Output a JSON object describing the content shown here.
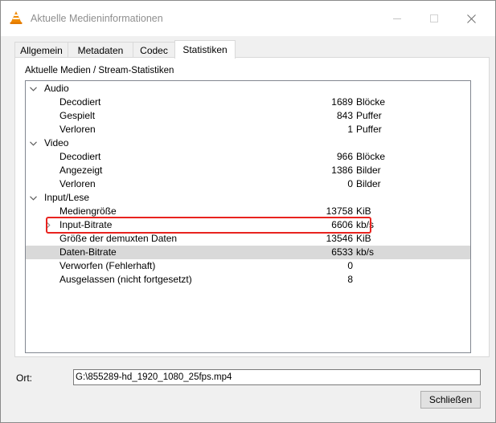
{
  "window": {
    "title": "Aktuelle Medieninformationen"
  },
  "tabs": [
    {
      "label": "Allgemein"
    },
    {
      "label": "Metadaten"
    },
    {
      "label": "Codec"
    },
    {
      "label": "Statistiken",
      "active": true
    }
  ],
  "panel": {
    "section_label": "Aktuelle Medien / Stream-Statistiken"
  },
  "tree": [
    {
      "label": "Audio",
      "level": 0,
      "expander": "expanded"
    },
    {
      "label": "Decodiert",
      "level": 1,
      "value": "1689",
      "unit": "Blöcke"
    },
    {
      "label": "Gespielt",
      "level": 1,
      "value": "843",
      "unit": "Puffer"
    },
    {
      "label": "Verloren",
      "level": 1,
      "value": "1",
      "unit": "Puffer"
    },
    {
      "label": "Video",
      "level": 0,
      "expander": "expanded"
    },
    {
      "label": "Decodiert",
      "level": 1,
      "value": "966",
      "unit": "Blöcke"
    },
    {
      "label": "Angezeigt",
      "level": 1,
      "value": "1386",
      "unit": "Bilder"
    },
    {
      "label": "Verloren",
      "level": 1,
      "value": "0",
      "unit": "Bilder"
    },
    {
      "label": "Input/Lese",
      "level": 0,
      "expander": "expanded"
    },
    {
      "label": "Mediengröße",
      "level": 1,
      "value": "13758",
      "unit": "KiB"
    },
    {
      "label": "Input-Bitrate",
      "level": 1,
      "value": "6606",
      "unit": "kb/s",
      "expander": "collapsed"
    },
    {
      "label": "Größe der demuxten Daten",
      "level": 1,
      "value": "13546",
      "unit": "KiB"
    },
    {
      "label": "Daten-Bitrate",
      "level": 1,
      "value": "6533",
      "unit": "kb/s",
      "selected": true,
      "highlighted": true
    },
    {
      "label": "Verworfen (Fehlerhaft)",
      "level": 1,
      "value": "0",
      "unit": ""
    },
    {
      "label": "Ausgelassen (nicht fortgesetzt)",
      "level": 1,
      "value": "8",
      "unit": ""
    }
  ],
  "location": {
    "label": "Ort:",
    "value": "G:\\855289-hd_1920_1080_25fps.mp4"
  },
  "buttons": {
    "close": "Schließen"
  },
  "colors": {
    "highlight_border": "#e8231f",
    "selected_row": "#d9d9d9"
  }
}
